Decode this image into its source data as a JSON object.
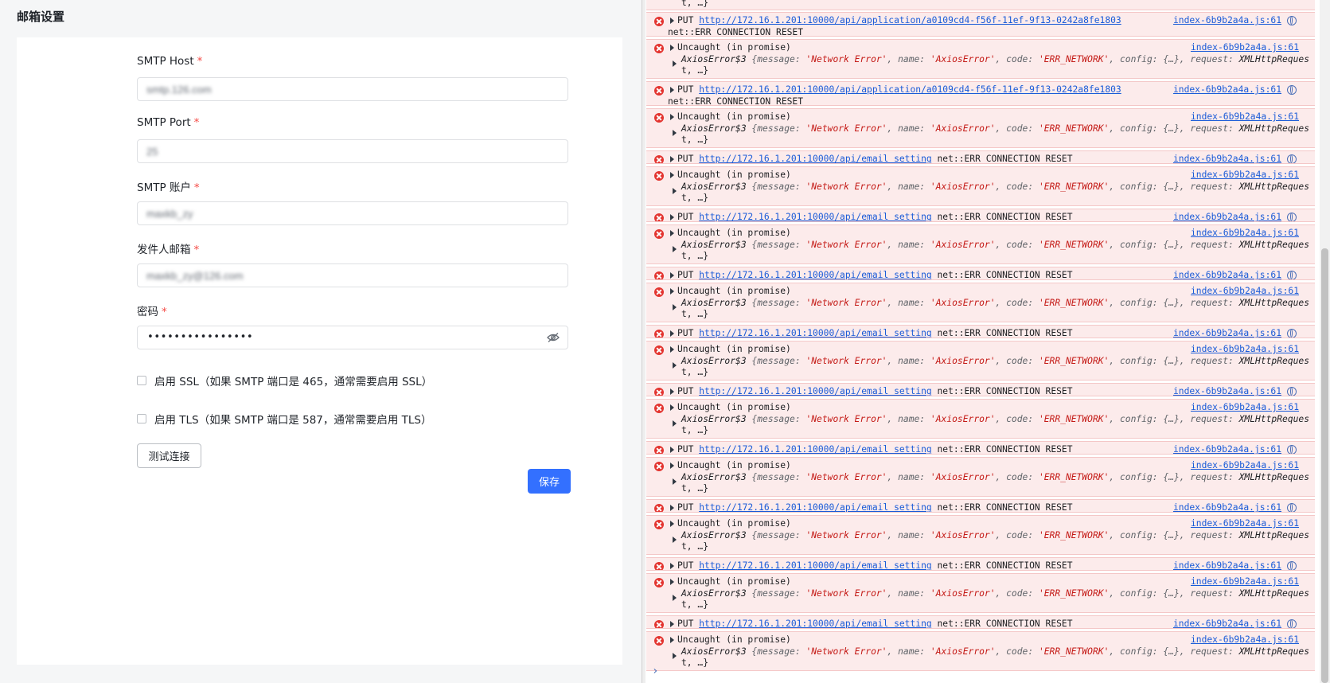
{
  "page": {
    "title": "邮箱设置"
  },
  "form": {
    "host": {
      "label": "SMTP Host",
      "required": "*",
      "value": "smtp.126.com"
    },
    "port": {
      "label": "SMTP Port",
      "required": "*",
      "value": "25"
    },
    "account": {
      "label": "SMTP 账户",
      "required": "*",
      "value": "maxkb_zy"
    },
    "sender": {
      "label": "发件人邮箱",
      "required": "*",
      "value": "maxkb_zy@126.com"
    },
    "password": {
      "label": "密码",
      "required": "*",
      "value": "••••••••••••••••"
    },
    "ssl_label": "启用 SSL（如果 SMTP 端口是 465，通常需要启用 SSL）",
    "tls_label": "启用 TLS（如果 SMTP 端口是 587，通常需要启用 TLS）",
    "test_button": "测试连接",
    "save_button": "保存"
  },
  "console": {
    "top_fragment": "t, …}",
    "put_prefix": "PUT",
    "url_app": "http://172.16.1.201:10000/api/application/a0109cd4-f56f-11ef-9f13-0242a8fe1803",
    "url_email": "http://172.16.1.201:10000/api/email_setting",
    "net_error": "net::ERR_CONNECTION_RESET",
    "source": "index-6b9b2a4a.js:61",
    "uncaught": "Uncaught (in promise)",
    "axios_name": "AxiosError$3",
    "axios_open": " {message: ",
    "axios_msg": "'Network Error'",
    "axios_mid1": ", name: ",
    "axios_name_val": "'AxiosError'",
    "axios_mid2": ", code: ",
    "axios_code": "'ERR_NETWORK'",
    "axios_mid3": ", config: {…}, request: ",
    "axios_req": "XMLHttpReques",
    "axios_tail": "t, …}",
    "prompt": "›",
    "colors": {
      "error_bg": "#fcebeb",
      "link": "#1a5bd8",
      "string": "#c41a16",
      "primary": "#3370ff"
    }
  }
}
